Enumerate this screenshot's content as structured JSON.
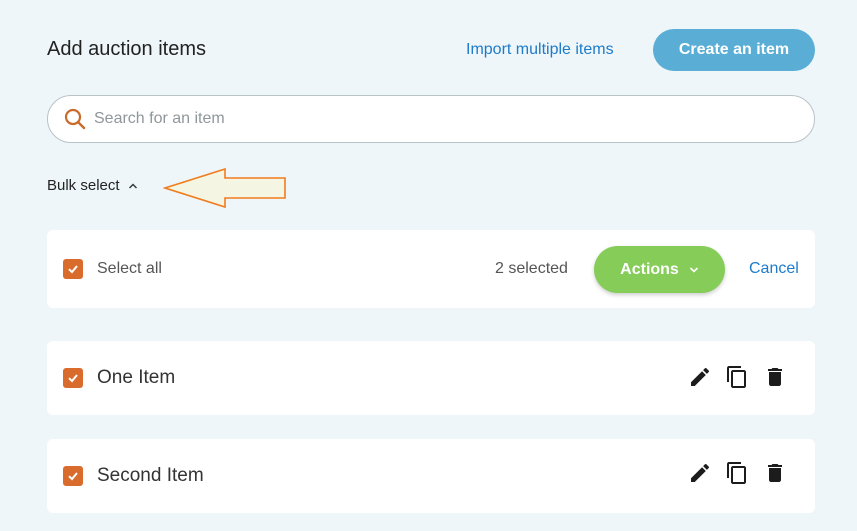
{
  "header": {
    "title": "Add auction items",
    "import_label": "Import multiple items",
    "create_label": "Create an item"
  },
  "search": {
    "placeholder": "Search for an item",
    "value": ""
  },
  "bulk": {
    "toggle_label": "Bulk select",
    "select_all_label": "Select all",
    "selected_count": "2 selected",
    "actions_label": "Actions",
    "cancel_label": "Cancel"
  },
  "items": [
    {
      "name": "One Item",
      "checked": true
    },
    {
      "name": "Second Item",
      "checked": true
    }
  ],
  "icons": {
    "search": "search-icon",
    "toggle": "chevron-up-icon",
    "actions": "chevron-down-icon",
    "edit": "pencil-icon",
    "copy": "copy-icon",
    "delete": "trash-icon",
    "annotation": "arrow-left-icon"
  },
  "colors": {
    "background": "#eef6f9",
    "link": "#1e7bc9",
    "create_button": "#5aaed6",
    "actions_button": "#86cc58",
    "checkbox": "#d96c2c",
    "annotation_stroke": "#f07c1c",
    "annotation_fill": "#f4f5e2"
  }
}
